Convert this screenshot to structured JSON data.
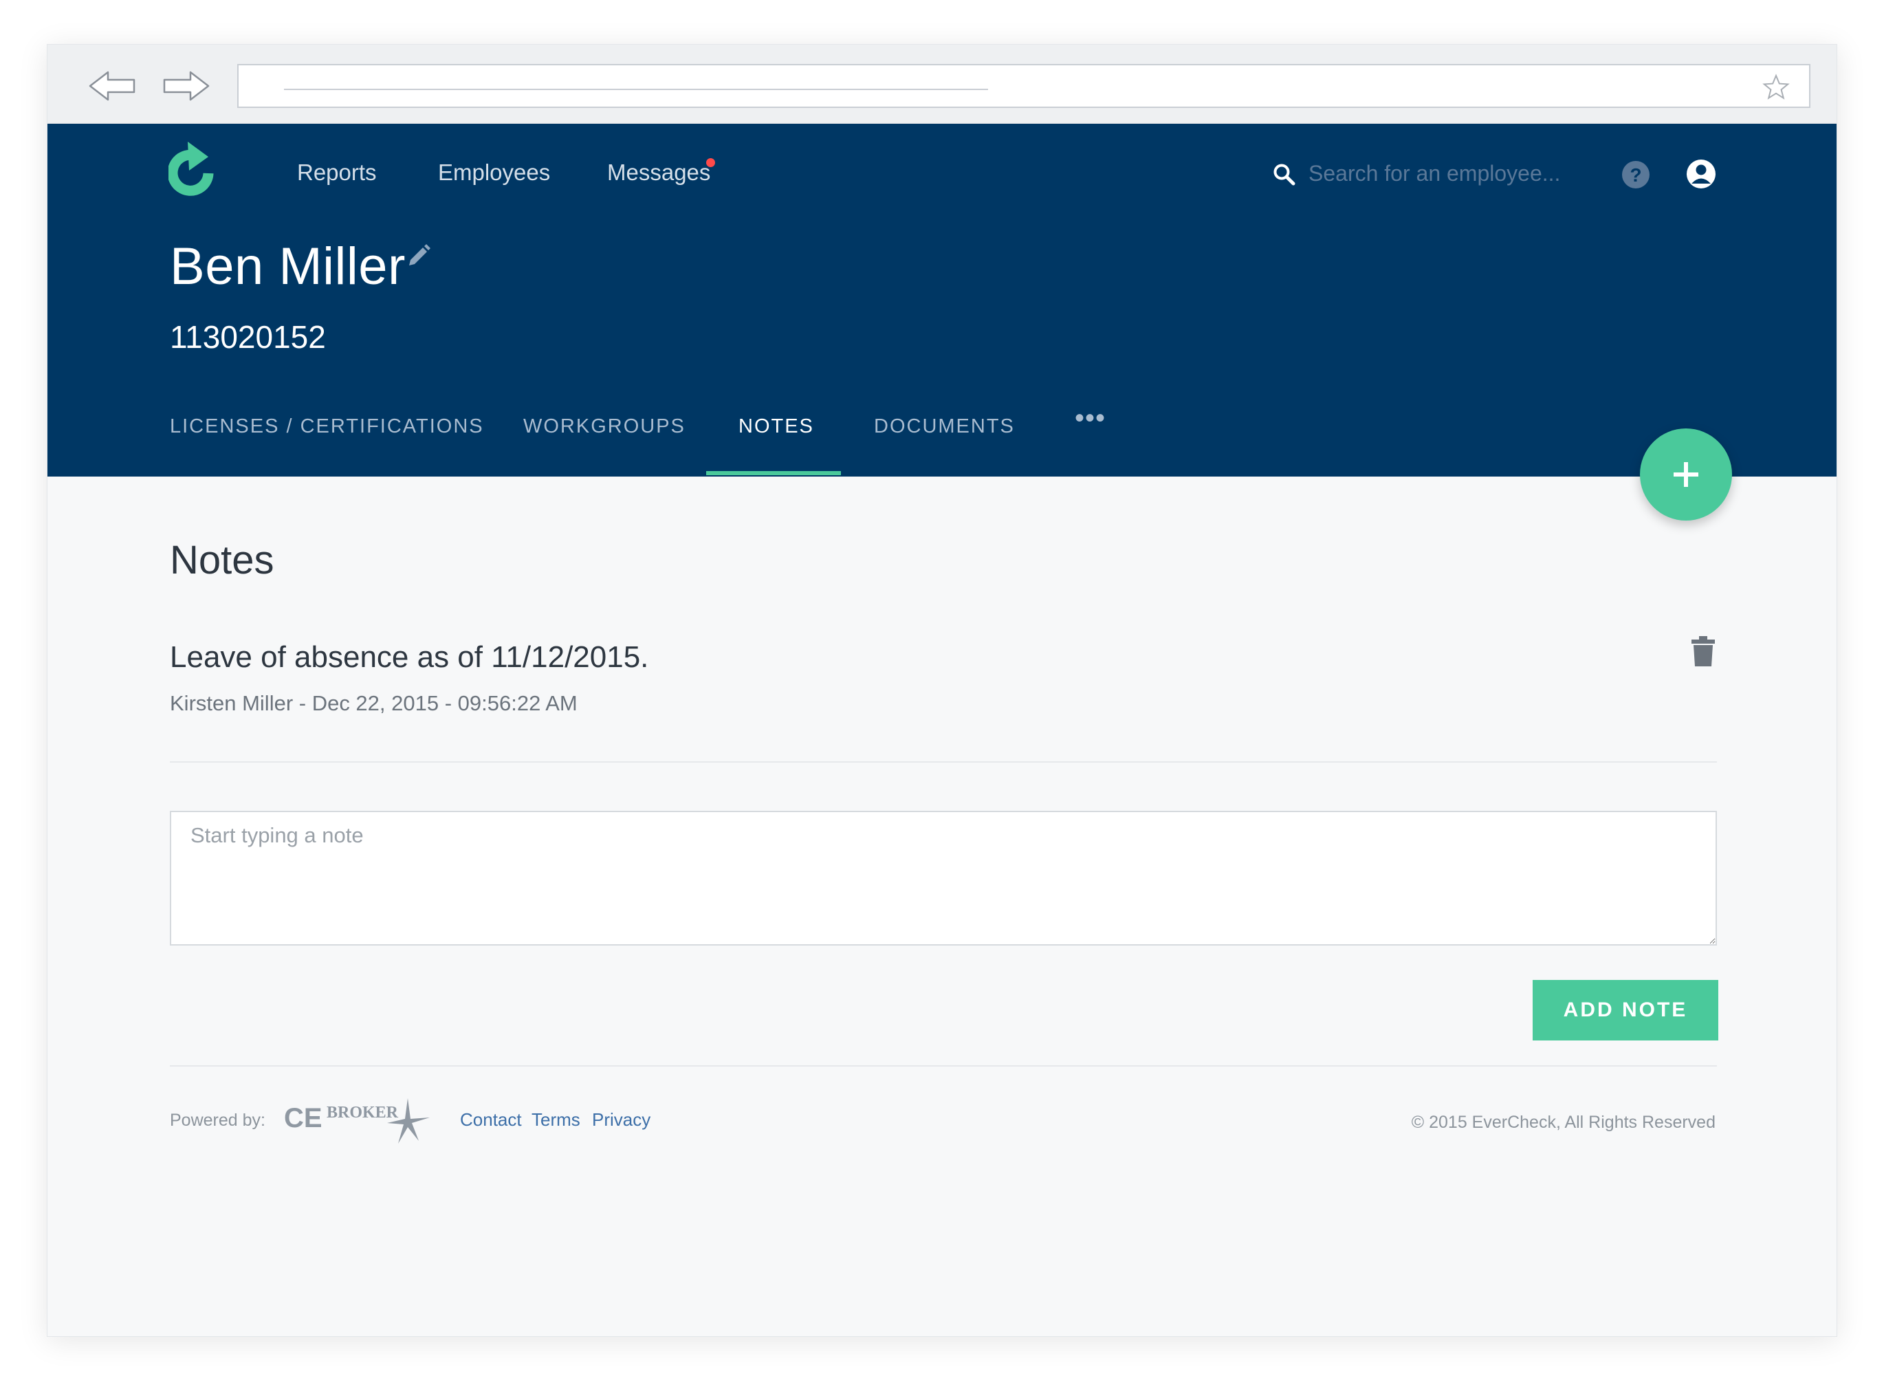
{
  "header": {
    "nav": {
      "reports": "Reports",
      "employees": "Employees",
      "messages": "Messages"
    },
    "search": {
      "placeholder": "Search for an employee..."
    }
  },
  "employee": {
    "name": "Ben Miller",
    "id": "113020152"
  },
  "tabs": [
    {
      "label": "LICENSES / CERTIFICATIONS"
    },
    {
      "label": "WORKGROUPS"
    },
    {
      "label": "NOTES",
      "active": true
    },
    {
      "label": "DOCUMENTS"
    },
    {
      "label": "•••"
    }
  ],
  "notes_section": {
    "title": "Notes",
    "notes": [
      {
        "text": "Leave of absence as of 11/12/2015.",
        "meta": "Kirsten Miller - Dec 22, 2015 - 09:56:22 AM"
      }
    ],
    "input_placeholder": "Start typing a note",
    "add_button": "ADD NOTE"
  },
  "footer": {
    "powered_by": "Powered by:",
    "brand_logo_text": "CE BROKER",
    "links": {
      "contact": "Contact",
      "terms": "Terms",
      "privacy": "Privacy"
    },
    "copyright": "© 2015 EverCheck, All Rights Reserved"
  },
  "colors": {
    "header_bg": "#003764",
    "accent": "#4ac99b",
    "notification_dot": "#ff4a4a",
    "link": "#3d6fa8"
  },
  "icons": [
    "back-arrow-icon",
    "forward-arrow-icon",
    "star-icon",
    "logo-icon",
    "search-icon",
    "help-icon",
    "user-icon",
    "edit-icon",
    "plus-icon",
    "trash-icon"
  ]
}
